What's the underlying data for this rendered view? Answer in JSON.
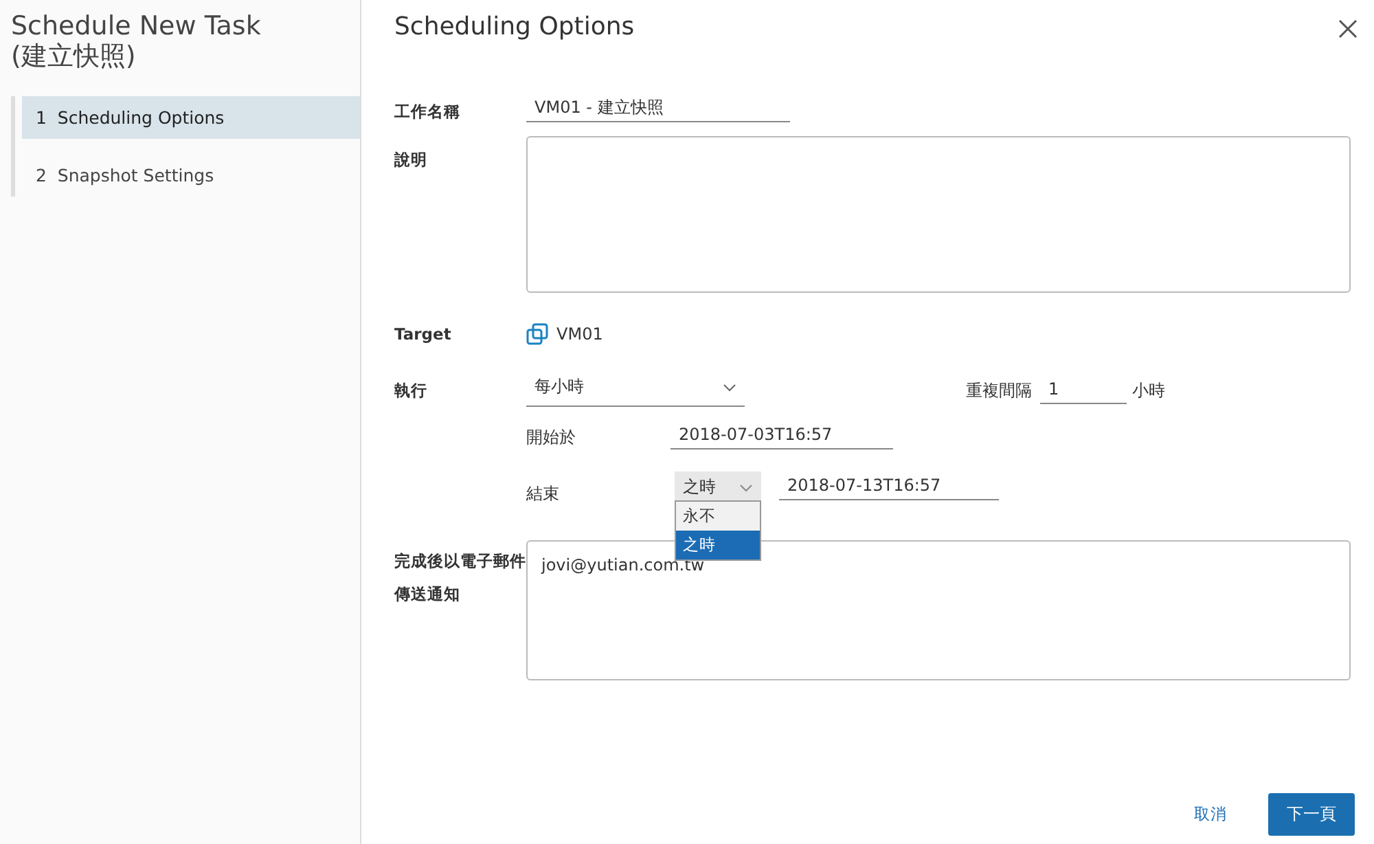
{
  "sidebar": {
    "title": "Schedule New Task",
    "subtitle": "(建立快照)",
    "steps": [
      {
        "number": "1",
        "label": "Scheduling Options",
        "selected": true
      },
      {
        "number": "2",
        "label": "Snapshot Settings",
        "selected": false
      }
    ]
  },
  "dialog": {
    "title": "Scheduling Options"
  },
  "form": {
    "task_name": {
      "label": "工作名稱",
      "value": "VM01 - 建立快照"
    },
    "description": {
      "label": "說明"
    },
    "target": {
      "label": "Target",
      "value": "VM01"
    },
    "run": {
      "label": "執行",
      "frequency": "每小時",
      "interval_label": "重複間隔",
      "interval": "1",
      "interval_unit": "小時",
      "start_label": "開始於",
      "start": "2018-07-03T16:57",
      "end_label": "結束",
      "end_mode": "之時",
      "end": "2018-07-13T16:57",
      "end_options": [
        {
          "label": "永不",
          "selected": false
        },
        {
          "label": "之時",
          "selected": true
        }
      ]
    },
    "email": {
      "label": "完成後以電子郵件傳送通知",
      "value": "jovi@yutian.com.tw"
    }
  },
  "buttons": {
    "cancel": "取消",
    "next": "下一頁"
  }
}
